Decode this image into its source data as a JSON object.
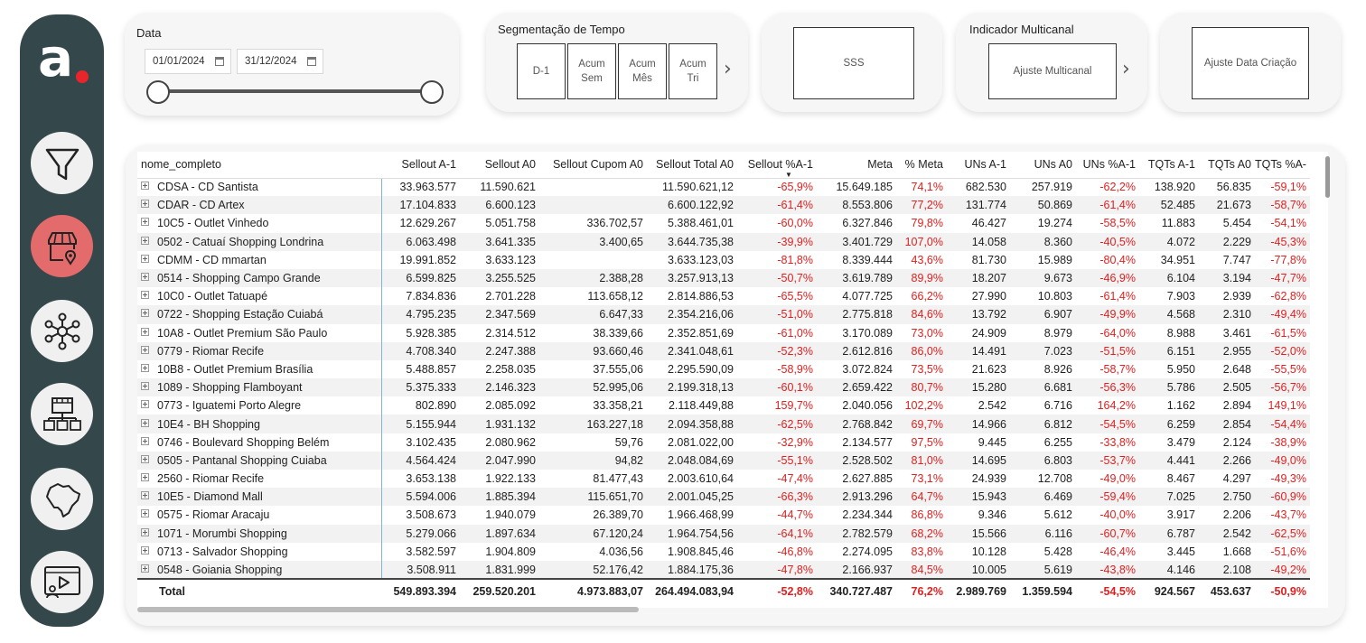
{
  "filters": {
    "date_title": "Data",
    "date_start": "01/01/2024",
    "date_end": "31/12/2024",
    "segment_title": "Segmentação de Tempo",
    "segments": [
      {
        "line1": "D-1",
        "line2": ""
      },
      {
        "line1": "Acum",
        "line2": "Sem"
      },
      {
        "line1": "Acum",
        "line2": "Mês"
      },
      {
        "line1": "Acum",
        "line2": "Tri"
      }
    ],
    "sss_label": "SSS",
    "multicanal_title": "Indicador Multicanal",
    "multicanal_button": "Ajuste Multicanal",
    "data_criacao_button": "Ajuste Data Criação"
  },
  "sidebar": {
    "logo_letter": "a",
    "items": [
      {
        "icon": "funnel-icon"
      },
      {
        "icon": "store-location-icon",
        "active": true
      },
      {
        "icon": "network-hub-icon"
      },
      {
        "icon": "store-network-icon"
      },
      {
        "icon": "brazil-map-icon"
      },
      {
        "icon": "presentation-icon"
      }
    ]
  },
  "table": {
    "columns": [
      "nome_completo",
      "Sellout A-1",
      "Sellout A0",
      "Sellout Cupom A0",
      "Sellout Total A0",
      "Sellout %A-1",
      "Meta",
      "% Meta",
      "UNs A-1",
      "UNs A0",
      "UNs %A-1",
      "TQTs A-1",
      "TQTs A0",
      "TQTs %A-"
    ],
    "rows": [
      [
        "CDSA - CD Santista",
        "33.963.577",
        "11.590.621",
        "",
        "11.590.621,12",
        "-65,9%",
        "15.649.185",
        "74,1%",
        "682.530",
        "257.919",
        "-62,2%",
        "138.920",
        "56.835",
        "-59,1%"
      ],
      [
        "CDAR - CD Artex",
        "17.104.833",
        "6.600.123",
        "",
        "6.600.122,92",
        "-61,4%",
        "8.553.806",
        "77,2%",
        "131.774",
        "50.869",
        "-61,4%",
        "52.485",
        "21.673",
        "-58,7%"
      ],
      [
        "10C5 - Outlet Vinhedo",
        "12.629.267",
        "5.051.758",
        "336.702,57",
        "5.388.461,01",
        "-60,0%",
        "6.327.846",
        "79,8%",
        "46.427",
        "19.274",
        "-58,5%",
        "11.883",
        "5.454",
        "-54,1%"
      ],
      [
        "0502 - Catuaí Shopping Londrina",
        "6.063.498",
        "3.641.335",
        "3.400,65",
        "3.644.735,38",
        "-39,9%",
        "3.401.729",
        "107,0%",
        "14.058",
        "8.360",
        "-40,5%",
        "4.072",
        "2.229",
        "-45,3%"
      ],
      [
        "CDMM - CD mmartan",
        "19.991.852",
        "3.633.123",
        "",
        "3.633.123,03",
        "-81,8%",
        "8.339.444",
        "43,6%",
        "81.730",
        "15.989",
        "-80,4%",
        "34.951",
        "7.747",
        "-77,8%"
      ],
      [
        "0514 - Shopping Campo Grande",
        "6.599.825",
        "3.255.525",
        "2.388,28",
        "3.257.913,13",
        "-50,7%",
        "3.619.789",
        "89,9%",
        "18.207",
        "9.673",
        "-46,9%",
        "6.104",
        "3.194",
        "-47,7%"
      ],
      [
        "10C0 - Outlet Tatuapé",
        "7.834.836",
        "2.701.228",
        "113.658,12",
        "2.814.886,53",
        "-65,5%",
        "4.077.725",
        "66,2%",
        "27.990",
        "10.803",
        "-61,4%",
        "7.903",
        "2.939",
        "-62,8%"
      ],
      [
        "0722 - Shopping Estação Cuiabá",
        "4.795.235",
        "2.347.569",
        "6.647,33",
        "2.354.216,06",
        "-51,0%",
        "2.775.818",
        "84,6%",
        "13.792",
        "6.907",
        "-49,9%",
        "4.568",
        "2.310",
        "-49,4%"
      ],
      [
        "10A8 - Outlet Premium São Paulo",
        "5.928.385",
        "2.314.512",
        "38.339,66",
        "2.352.851,69",
        "-61,0%",
        "3.170.089",
        "73,0%",
        "24.909",
        "8.979",
        "-64,0%",
        "8.988",
        "3.461",
        "-61,5%"
      ],
      [
        "0779 - Riomar Recife",
        "4.708.340",
        "2.247.388",
        "93.660,46",
        "2.341.048,61",
        "-52,3%",
        "2.612.816",
        "86,0%",
        "14.491",
        "7.023",
        "-51,5%",
        "6.151",
        "2.955",
        "-52,0%"
      ],
      [
        "10B8 - Outlet Premium Brasília",
        "5.488.857",
        "2.258.035",
        "37.555,06",
        "2.295.590,09",
        "-58,9%",
        "3.072.824",
        "73,5%",
        "21.623",
        "8.926",
        "-58,7%",
        "5.950",
        "2.648",
        "-55,5%"
      ],
      [
        "1089 - Shopping Flamboyant",
        "5.375.333",
        "2.146.323",
        "52.995,06",
        "2.199.318,13",
        "-60,1%",
        "2.659.422",
        "80,7%",
        "15.280",
        "6.681",
        "-56,3%",
        "5.786",
        "2.505",
        "-56,7%"
      ],
      [
        "0773 - Iguatemi Porto Alegre",
        "802.890",
        "2.085.092",
        "33.358,21",
        "2.118.449,88",
        "159,7%",
        "2.040.056",
        "102,2%",
        "2.542",
        "6.716",
        "164,2%",
        "1.162",
        "2.894",
        "149,1%"
      ],
      [
        "10E4 - BH Shopping",
        "5.155.944",
        "1.931.132",
        "163.227,18",
        "2.094.358,88",
        "-62,5%",
        "2.768.842",
        "69,7%",
        "14.966",
        "6.812",
        "-54,5%",
        "6.259",
        "2.854",
        "-54,4%"
      ],
      [
        "0746 - Boulevard Shopping Belém",
        "3.102.435",
        "2.080.962",
        "59,76",
        "2.081.022,00",
        "-32,9%",
        "2.134.577",
        "97,5%",
        "9.445",
        "6.255",
        "-33,8%",
        "3.479",
        "2.124",
        "-38,9%"
      ],
      [
        "0505 - Pantanal Shopping Cuiaba",
        "4.564.424",
        "2.047.990",
        "94,82",
        "2.048.084,69",
        "-55,1%",
        "2.528.502",
        "81,0%",
        "14.695",
        "6.803",
        "-53,7%",
        "4.441",
        "2.266",
        "-49,0%"
      ],
      [
        "2560 - Riomar Recife",
        "3.653.138",
        "1.922.133",
        "81.477,43",
        "2.003.610,64",
        "-47,4%",
        "2.627.885",
        "73,1%",
        "24.939",
        "12.708",
        "-49,0%",
        "8.467",
        "4.297",
        "-49,3%"
      ],
      [
        "10E5 - Diamond Mall",
        "5.594.006",
        "1.885.394",
        "115.651,70",
        "2.001.045,25",
        "-66,3%",
        "2.913.296",
        "64,7%",
        "15.943",
        "6.469",
        "-59,4%",
        "7.025",
        "2.750",
        "-60,9%"
      ],
      [
        "0575 - Riomar Aracaju",
        "3.508.673",
        "1.940.079",
        "26.389,70",
        "1.966.468,99",
        "-44,7%",
        "2.234.344",
        "86,8%",
        "9.346",
        "5.612",
        "-40,0%",
        "3.917",
        "2.206",
        "-43,7%"
      ],
      [
        "1071 - Morumbi Shopping",
        "5.279.066",
        "1.897.634",
        "67.120,24",
        "1.964.754,56",
        "-64,1%",
        "2.782.579",
        "68,2%",
        "15.566",
        "6.116",
        "-60,7%",
        "6.787",
        "2.542",
        "-62,5%"
      ],
      [
        "0713 - Salvador Shopping",
        "3.582.597",
        "1.904.809",
        "4.036,56",
        "1.908.845,46",
        "-46,8%",
        "2.274.095",
        "83,8%",
        "10.128",
        "5.428",
        "-46,4%",
        "3.445",
        "1.668",
        "-51,6%"
      ],
      [
        "0548 - Goiania Shopping",
        "3.508.911",
        "1.831.999",
        "52.176,42",
        "1.884.175,36",
        "-47,8%",
        "2.166.937",
        "84,5%",
        "10.005",
        "5.619",
        "-43,8%",
        "4.146",
        "2.108",
        "-49,2%"
      ]
    ],
    "total": [
      "Total",
      "549.893.394",
      "259.520.201",
      "4.973.883,07",
      "264.494.083,94",
      "-52,8%",
      "340.727.487",
      "76,2%",
      "2.989.769",
      "1.359.594",
      "-54,5%",
      "924.567",
      "453.637",
      "-50,9%"
    ],
    "colors": {
      "negative": "#e02020",
      "highlight": "#e02020"
    }
  }
}
